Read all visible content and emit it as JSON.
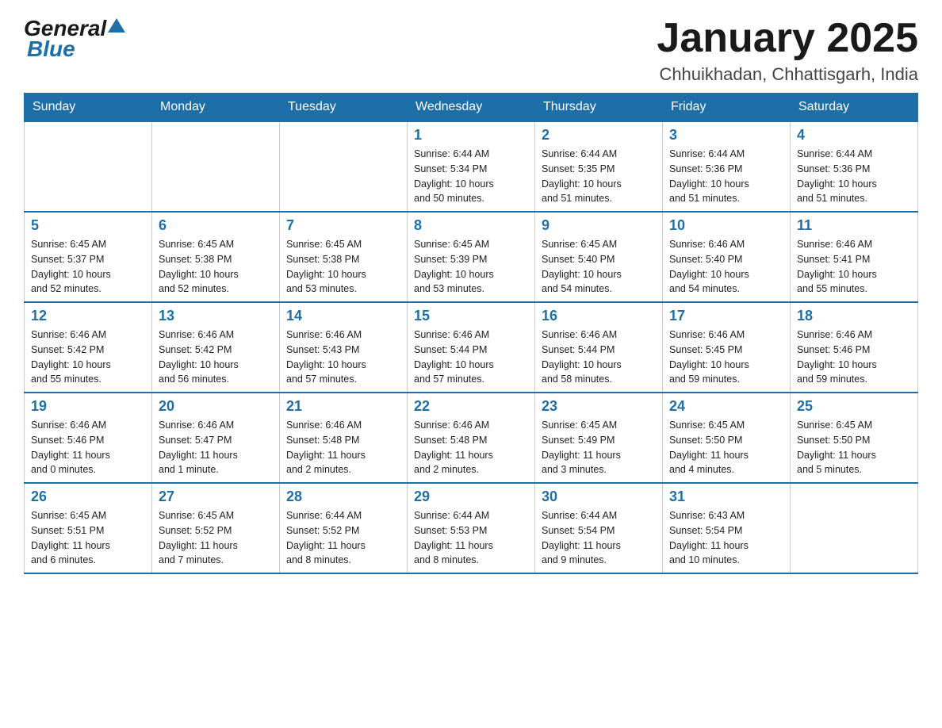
{
  "header": {
    "logo": {
      "general": "General",
      "blue": "Blue"
    },
    "title": "January 2025",
    "subtitle": "Chhuikhadan, Chhattisgarh, India"
  },
  "days_of_week": [
    "Sunday",
    "Monday",
    "Tuesday",
    "Wednesday",
    "Thursday",
    "Friday",
    "Saturday"
  ],
  "weeks": [
    [
      {
        "day": "",
        "info": ""
      },
      {
        "day": "",
        "info": ""
      },
      {
        "day": "",
        "info": ""
      },
      {
        "day": "1",
        "info": "Sunrise: 6:44 AM\nSunset: 5:34 PM\nDaylight: 10 hours\nand 50 minutes."
      },
      {
        "day": "2",
        "info": "Sunrise: 6:44 AM\nSunset: 5:35 PM\nDaylight: 10 hours\nand 51 minutes."
      },
      {
        "day": "3",
        "info": "Sunrise: 6:44 AM\nSunset: 5:36 PM\nDaylight: 10 hours\nand 51 minutes."
      },
      {
        "day": "4",
        "info": "Sunrise: 6:44 AM\nSunset: 5:36 PM\nDaylight: 10 hours\nand 51 minutes."
      }
    ],
    [
      {
        "day": "5",
        "info": "Sunrise: 6:45 AM\nSunset: 5:37 PM\nDaylight: 10 hours\nand 52 minutes."
      },
      {
        "day": "6",
        "info": "Sunrise: 6:45 AM\nSunset: 5:38 PM\nDaylight: 10 hours\nand 52 minutes."
      },
      {
        "day": "7",
        "info": "Sunrise: 6:45 AM\nSunset: 5:38 PM\nDaylight: 10 hours\nand 53 minutes."
      },
      {
        "day": "8",
        "info": "Sunrise: 6:45 AM\nSunset: 5:39 PM\nDaylight: 10 hours\nand 53 minutes."
      },
      {
        "day": "9",
        "info": "Sunrise: 6:45 AM\nSunset: 5:40 PM\nDaylight: 10 hours\nand 54 minutes."
      },
      {
        "day": "10",
        "info": "Sunrise: 6:46 AM\nSunset: 5:40 PM\nDaylight: 10 hours\nand 54 minutes."
      },
      {
        "day": "11",
        "info": "Sunrise: 6:46 AM\nSunset: 5:41 PM\nDaylight: 10 hours\nand 55 minutes."
      }
    ],
    [
      {
        "day": "12",
        "info": "Sunrise: 6:46 AM\nSunset: 5:42 PM\nDaylight: 10 hours\nand 55 minutes."
      },
      {
        "day": "13",
        "info": "Sunrise: 6:46 AM\nSunset: 5:42 PM\nDaylight: 10 hours\nand 56 minutes."
      },
      {
        "day": "14",
        "info": "Sunrise: 6:46 AM\nSunset: 5:43 PM\nDaylight: 10 hours\nand 57 minutes."
      },
      {
        "day": "15",
        "info": "Sunrise: 6:46 AM\nSunset: 5:44 PM\nDaylight: 10 hours\nand 57 minutes."
      },
      {
        "day": "16",
        "info": "Sunrise: 6:46 AM\nSunset: 5:44 PM\nDaylight: 10 hours\nand 58 minutes."
      },
      {
        "day": "17",
        "info": "Sunrise: 6:46 AM\nSunset: 5:45 PM\nDaylight: 10 hours\nand 59 minutes."
      },
      {
        "day": "18",
        "info": "Sunrise: 6:46 AM\nSunset: 5:46 PM\nDaylight: 10 hours\nand 59 minutes."
      }
    ],
    [
      {
        "day": "19",
        "info": "Sunrise: 6:46 AM\nSunset: 5:46 PM\nDaylight: 11 hours\nand 0 minutes."
      },
      {
        "day": "20",
        "info": "Sunrise: 6:46 AM\nSunset: 5:47 PM\nDaylight: 11 hours\nand 1 minute."
      },
      {
        "day": "21",
        "info": "Sunrise: 6:46 AM\nSunset: 5:48 PM\nDaylight: 11 hours\nand 2 minutes."
      },
      {
        "day": "22",
        "info": "Sunrise: 6:46 AM\nSunset: 5:48 PM\nDaylight: 11 hours\nand 2 minutes."
      },
      {
        "day": "23",
        "info": "Sunrise: 6:45 AM\nSunset: 5:49 PM\nDaylight: 11 hours\nand 3 minutes."
      },
      {
        "day": "24",
        "info": "Sunrise: 6:45 AM\nSunset: 5:50 PM\nDaylight: 11 hours\nand 4 minutes."
      },
      {
        "day": "25",
        "info": "Sunrise: 6:45 AM\nSunset: 5:50 PM\nDaylight: 11 hours\nand 5 minutes."
      }
    ],
    [
      {
        "day": "26",
        "info": "Sunrise: 6:45 AM\nSunset: 5:51 PM\nDaylight: 11 hours\nand 6 minutes."
      },
      {
        "day": "27",
        "info": "Sunrise: 6:45 AM\nSunset: 5:52 PM\nDaylight: 11 hours\nand 7 minutes."
      },
      {
        "day": "28",
        "info": "Sunrise: 6:44 AM\nSunset: 5:52 PM\nDaylight: 11 hours\nand 8 minutes."
      },
      {
        "day": "29",
        "info": "Sunrise: 6:44 AM\nSunset: 5:53 PM\nDaylight: 11 hours\nand 8 minutes."
      },
      {
        "day": "30",
        "info": "Sunrise: 6:44 AM\nSunset: 5:54 PM\nDaylight: 11 hours\nand 9 minutes."
      },
      {
        "day": "31",
        "info": "Sunrise: 6:43 AM\nSunset: 5:54 PM\nDaylight: 11 hours\nand 10 minutes."
      },
      {
        "day": "",
        "info": ""
      }
    ]
  ]
}
